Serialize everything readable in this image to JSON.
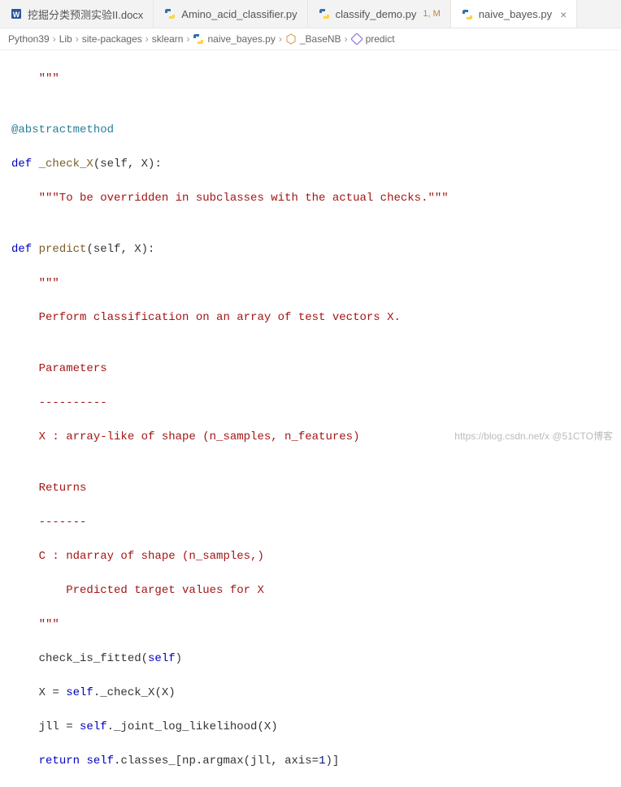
{
  "tabs": [
    {
      "label": "挖掘分类预测实验II.docx",
      "type": "doc",
      "active": false,
      "badge": "",
      "closable": false
    },
    {
      "label": "Amino_acid_classifier.py",
      "type": "py",
      "active": false,
      "badge": "",
      "closable": false
    },
    {
      "label": "classify_demo.py",
      "type": "py",
      "active": false,
      "badge": "1, M",
      "closable": false
    },
    {
      "label": "naive_bayes.py",
      "type": "py",
      "active": true,
      "badge": "",
      "closable": true
    }
  ],
  "breadcrumb": {
    "p0": "Python39",
    "p1": "Lib",
    "p2": "site-packages",
    "p3": "sklearn",
    "p4": "naive_bayes.py",
    "p5": "_BaseNB",
    "p6": "predict"
  },
  "code": {
    "l01": "    \"\"\"",
    "l02": "",
    "l03": "@abstractmethod",
    "l04_def": "def",
    "l04_fn": " _check_X",
    "l04_rest": "(self, X):",
    "l05": "    \"\"\"To be overridden in subclasses with the actual checks.\"\"\"",
    "l06": "",
    "l07_def": "def",
    "l07_fn": " predict",
    "l07_rest": "(self, X):",
    "l08": "    \"\"\"",
    "l09": "    Perform classification on an array of test vectors X.",
    "l10": "",
    "l11": "    Parameters",
    "l12": "    ----------",
    "l13": "    X : array-like of shape (n_samples, n_features)",
    "l14": "",
    "l15": "    Returns",
    "l16": "    -------",
    "l17": "    C : ndarray of shape (n_samples,)",
    "l18": "        Predicted target values for X",
    "l19": "    \"\"\"",
    "l20a": "    check_is_fitted(",
    "l20b": "self",
    "l20c": ")",
    "l21a": "    X = ",
    "l21b": "self",
    "l21c": "._check_X(X)",
    "l22a": "    jll = ",
    "l22b": "self",
    "l22c": "._joint_log_likelihood(X)",
    "l23a": "    ",
    "l23b": "return",
    "l23c": " ",
    "l23d": "self",
    "l23e": ".classes_[np.argmax(jll, axis=",
    "l23f": "1",
    "l23g": ")]"
  },
  "watermark": "https://blog.csdn.net/x @51CTO博客"
}
